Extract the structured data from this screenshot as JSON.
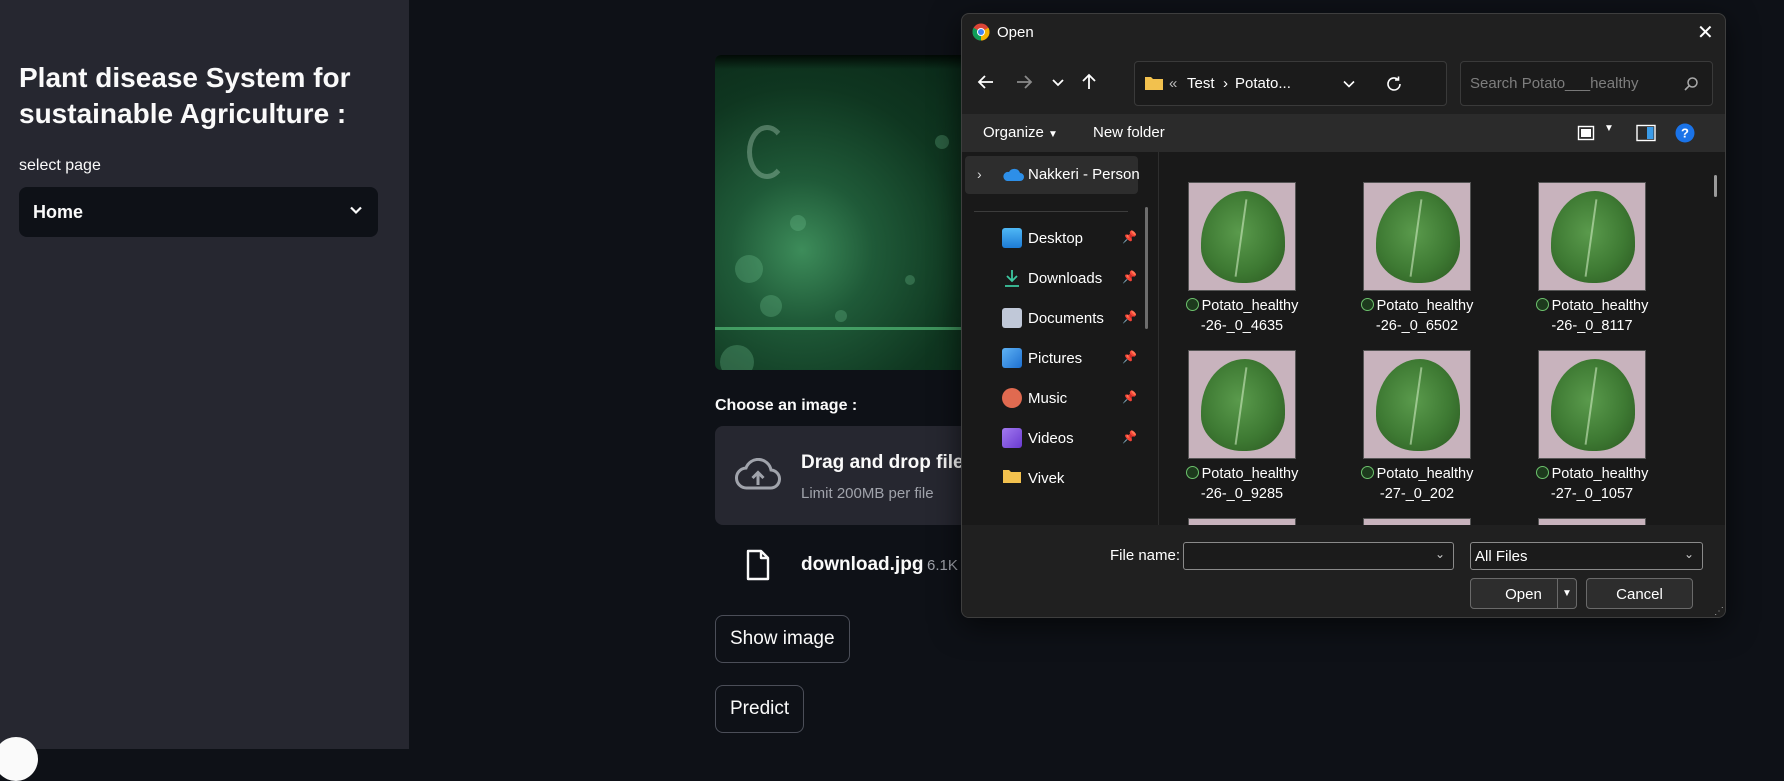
{
  "sidebar": {
    "title": "Plant disease System for sustainable Agriculture :",
    "select_label": "select page",
    "select_value": "Home"
  },
  "main": {
    "hero_title_fragment": "· |· ·|·",
    "choose_label": "Choose an image :",
    "dropzone": {
      "title": "Drag and drop file h",
      "limit": "Limit 200MB per file"
    },
    "file": {
      "name": "download.jpg",
      "size": "6.1K"
    },
    "show_image_button": "Show image",
    "predict_button": "Predict"
  },
  "dialog": {
    "title": "Open",
    "address": {
      "overflow": "«",
      "crumb1": "Test",
      "crumb2": "Potato..."
    },
    "search_placeholder": "Search Potato___healthy",
    "toolbar": {
      "organize": "Organize",
      "new_folder": "New folder"
    },
    "tree": {
      "top_item": "Nakkeri - Person",
      "items": [
        {
          "label": "Desktop",
          "icon": "desktop-icon",
          "color": "#3aa0f0",
          "pinned": true
        },
        {
          "label": "Downloads",
          "icon": "download-icon",
          "color": "#3cc8a0",
          "pinned": true
        },
        {
          "label": "Documents",
          "icon": "document-icon",
          "color": "#c0c8d8",
          "pinned": true
        },
        {
          "label": "Pictures",
          "icon": "pictures-icon",
          "color": "#3a8ee8",
          "pinned": true
        },
        {
          "label": "Music",
          "icon": "music-icon",
          "color": "#e06a50",
          "pinned": true
        },
        {
          "label": "Videos",
          "icon": "videos-icon",
          "color": "#8a5ae0",
          "pinned": true
        },
        {
          "label": "Vivek",
          "icon": "folder-icon",
          "color": "#f2c14e",
          "pinned": false
        }
      ]
    },
    "files": [
      {
        "line1": "Potato_healthy",
        "line2": "-26-_0_4635"
      },
      {
        "line1": "Potato_healthy",
        "line2": "-26-_0_6502"
      },
      {
        "line1": "Potato_healthy",
        "line2": "-26-_0_8117"
      },
      {
        "line1": "Potato_healthy",
        "line2": "-26-_0_9285"
      },
      {
        "line1": "Potato_healthy",
        "line2": "-27-_0_202"
      },
      {
        "line1": "Potato_healthy",
        "line2": "-27-_0_1057"
      }
    ],
    "file_name_label": "File name:",
    "file_name_value": "",
    "file_type": "All Files",
    "open_button": "Open",
    "cancel_button": "Cancel"
  },
  "colors": {
    "app_bg": "#0e1117",
    "sidebar_bg": "#262730",
    "dialog_bg": "#202020",
    "help_blue": "#1a73e8"
  }
}
